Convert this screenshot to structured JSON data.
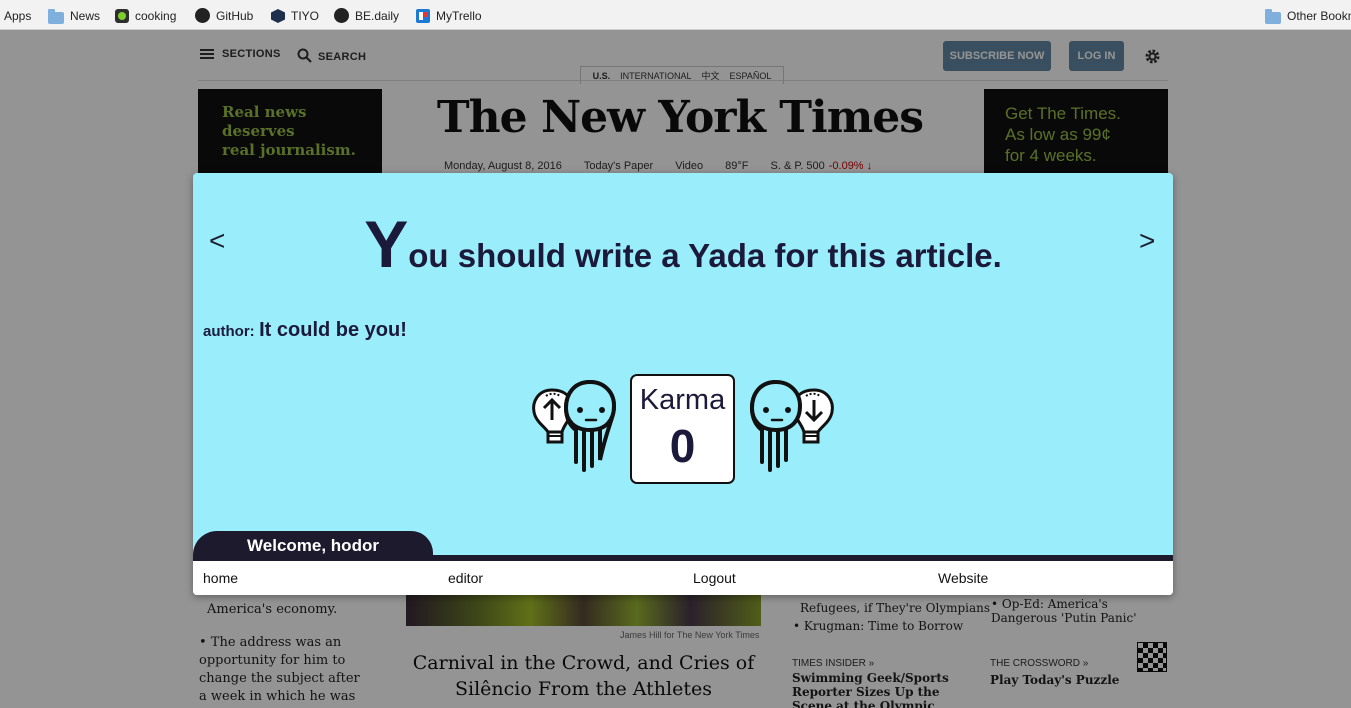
{
  "bookmarks": {
    "items": [
      {
        "label": "Apps",
        "icon": "apps-grid-icon"
      },
      {
        "label": "News",
        "icon": "folder-icon"
      },
      {
        "label": "cooking",
        "icon": "cooking-icon"
      },
      {
        "label": "GitHub",
        "icon": "github-icon"
      },
      {
        "label": "TIYO",
        "icon": "tiyo-icon"
      },
      {
        "label": "BE.daily",
        "icon": "github-icon"
      },
      {
        "label": "MyTrello",
        "icon": "trello-icon"
      }
    ],
    "other": {
      "label": "Other Bookm",
      "icon": "folder-icon"
    }
  },
  "nyt": {
    "sections_label": "SECTIONS",
    "search_label": "SEARCH",
    "subscribe_label": "SUBSCRIBE NOW",
    "login_label": "LOG IN",
    "editions": [
      "U.S.",
      "INTERNATIONAL",
      "中文",
      "ESPAÑOL"
    ],
    "ad_left": [
      "Real news",
      "deserves",
      "real journalism."
    ],
    "ad_right": [
      "Get The Times.",
      "As low as 99¢",
      "for 4 weeks."
    ],
    "masthead": "The New York Times",
    "date": "Monday, August 8, 2016",
    "todays_paper": "Today's Paper",
    "video": "Video",
    "weather": "89°F",
    "market_label": "S. & P. 500",
    "market_change": "-0.09% ↓",
    "left_story_1": "would revitalize America's economy.",
    "left_story_2": "• The address was an opportunity for him to change the subject after a week in which he was",
    "photo_credit": "James Hill for The New York Times",
    "main_headline": "Carnival in the Crowd, and Cries of Silêncio From the Athletes",
    "right_story_1": "Refugees, if They're Olympians",
    "right_story_2": "• Krugman: Time to Borrow",
    "right_story_3": "• Op-Ed: America's Dangerous 'Putin Panic'",
    "times_insider_kicker": "TIMES INSIDER »",
    "times_insider_story": "Swimming Geek/Sports Reporter Sizes Up the Scene at the Olympic Pool in Rio",
    "crossword_kicker": "THE CROSSWORD »",
    "crossword_story": "Play Today's Puzzle"
  },
  "yada": {
    "prev_arrow": "<",
    "next_arrow": ">",
    "title_initial": "Y",
    "title_rest": "ou should write a Yada for this article.",
    "author_label": "author:",
    "author_value": "It could be you!",
    "karma_label": "Karma",
    "karma_value": "0",
    "welcome": "Welcome, hodor",
    "nav": [
      "home",
      "editor",
      "Logout",
      "Website"
    ],
    "colors": {
      "panel_bg": "#9aedfb",
      "text": "#1c1a3a",
      "bar": "#1d1a2e"
    }
  }
}
